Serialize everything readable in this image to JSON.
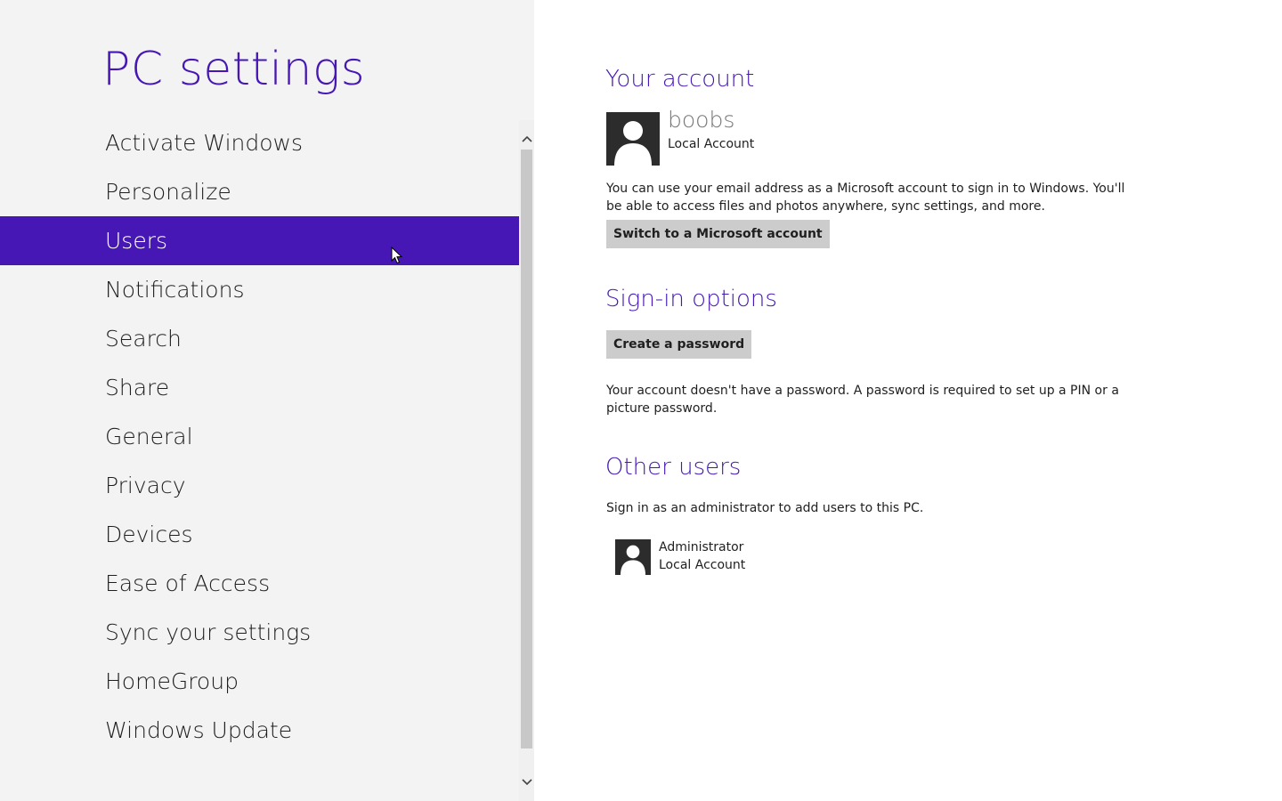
{
  "nav": {
    "title": "PC settings",
    "items": [
      {
        "label": "Activate Windows"
      },
      {
        "label": "Personalize"
      },
      {
        "label": "Users"
      },
      {
        "label": "Notifications"
      },
      {
        "label": "Search"
      },
      {
        "label": "Share"
      },
      {
        "label": "General"
      },
      {
        "label": "Privacy"
      },
      {
        "label": "Devices"
      },
      {
        "label": "Ease of Access"
      },
      {
        "label": "Sync your settings"
      },
      {
        "label": "HomeGroup"
      },
      {
        "label": "Windows Update"
      }
    ],
    "selected": "Users"
  },
  "account": {
    "heading": "Your account",
    "user_name": "boobs",
    "account_type": "Local Account",
    "description": "You can use your email address as a Microsoft account to sign in to Windows. You'll be able to access files and photos anywhere, sync settings, and more.",
    "switch_button": "Switch to a Microsoft account"
  },
  "signin": {
    "heading": "Sign-in options",
    "create_password_button": "Create a password",
    "description": "Your account doesn't have a password. A password is required to set up a PIN or a picture password."
  },
  "other_users": {
    "heading": "Other users",
    "description": "Sign in as an administrator to add users to this PC.",
    "users": [
      {
        "name": "Administrator",
        "type": "Local Account"
      }
    ]
  },
  "colors": {
    "accent": "#4617b4",
    "nav_background": "#f3f3f3",
    "button_background": "#cccccc"
  },
  "icons": {
    "avatar": "user-silhouette-icon",
    "scroll_up": "chevron-up-icon",
    "scroll_down": "chevron-down-icon",
    "cursor": "mouse-pointer-icon"
  }
}
